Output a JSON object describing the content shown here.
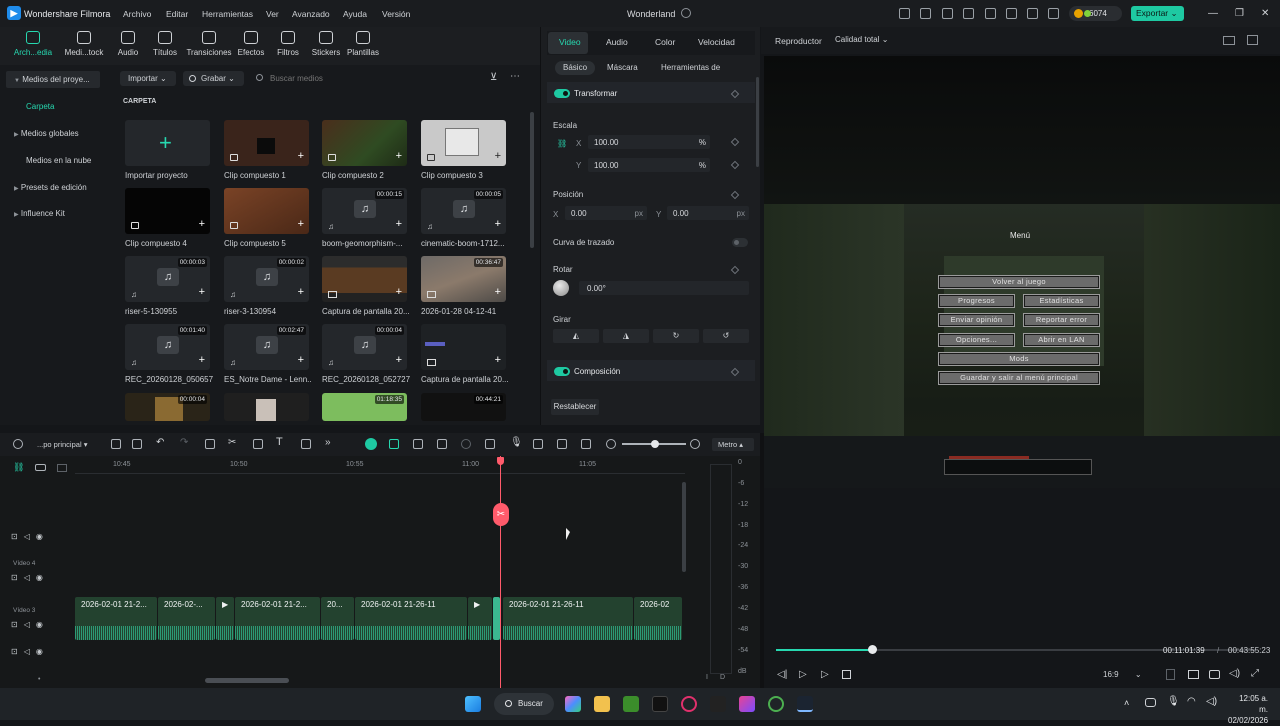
{
  "app": {
    "name": "Wondershare Filmora",
    "project_title": "Wonderland"
  },
  "menu": [
    "Archivo",
    "Editar",
    "Herramientas",
    "Ver",
    "Avanzado",
    "Ayuda",
    "Versión"
  ],
  "credits": "6074",
  "export_label": "Exportar",
  "media_toolbar": [
    "Arch...edia",
    "Medi...tock",
    "Audio",
    "Títulos",
    "Transiciones",
    "Efectos",
    "Filtros",
    "Stickers",
    "Plantillas"
  ],
  "sidebar": [
    "Medios del proye...",
    "Carpeta",
    "Medios globales",
    "Medios en la nube",
    "Presets de edición",
    "Influence Kit"
  ],
  "media_bar": {
    "import": "Importar",
    "record": "Grabar",
    "search_placeholder": "Buscar medios",
    "folder": "CARPETA"
  },
  "media_items": [
    {
      "label": "Importar proyecto",
      "dur": ""
    },
    {
      "label": "Clip compuesto 1",
      "dur": ""
    },
    {
      "label": "Clip compuesto 2",
      "dur": ""
    },
    {
      "label": "Clip compuesto 3",
      "dur": ""
    },
    {
      "label": "Clip compuesto 4",
      "dur": ""
    },
    {
      "label": "Clip compuesto 5",
      "dur": ""
    },
    {
      "label": "boom-geomorphism-...",
      "dur": "00:00:15"
    },
    {
      "label": "cinematic-boom-1712...",
      "dur": "00:00:05"
    },
    {
      "label": "riser-5-130955",
      "dur": "00:00:03"
    },
    {
      "label": "riser-3-130954",
      "dur": "00:00:02"
    },
    {
      "label": "Captura de pantalla 20...",
      "dur": ""
    },
    {
      "label": "2026-01-28 04-12-41",
      "dur": "00:36:47"
    },
    {
      "label": "REC_20260128_050657",
      "dur": "00:01:40"
    },
    {
      "label": "ES_Notre Dame - Lenn...",
      "dur": "00:02:47"
    },
    {
      "label": "REC_20260128_052727",
      "dur": "00:00:04"
    },
    {
      "label": "Captura de pantalla 20...",
      "dur": ""
    },
    {
      "label": "",
      "dur": "00:00:04"
    },
    {
      "label": "",
      "dur": ""
    },
    {
      "label": "",
      "dur": "01:18:35"
    },
    {
      "label": "",
      "dur": "00:44:21"
    }
  ],
  "props": {
    "tabs": [
      "Video",
      "Audio",
      "Color",
      "Velocidad"
    ],
    "subtabs": [
      "Básico",
      "Máscara",
      "Herramientas de"
    ],
    "transform": "Transformar",
    "scale": "Escala",
    "scale_x": "100.00",
    "scale_y": "100.00",
    "percent": "%",
    "x": "X",
    "y": "Y",
    "position": "Posición",
    "pos_x": "0.00",
    "pos_y": "0.00",
    "px": "px",
    "path_curve": "Curva de trazado",
    "rotate": "Rotar",
    "rotate_val": "0.00°",
    "flip": "Girar",
    "composition": "Composición",
    "reset": "Restablecer"
  },
  "player": {
    "label": "Reproductor",
    "quality": "Calidad total",
    "current_time": "00:11:01:39",
    "sep": "/",
    "total_time": "00:43:55:23",
    "progress": 0.2,
    "aspect": "16:9"
  },
  "game_menu": {
    "title": "Menú",
    "back": "Volver al juego",
    "progress": "Progresos",
    "stats": "Estadísticas",
    "feedback": "Enviar opinión",
    "report": "Reportar error",
    "options": "Opciones...",
    "lan": "Abrir en LAN",
    "mods": "Mods",
    "save_quit": "Guardar y salir al menú principal"
  },
  "timeline": {
    "track_name": "...po principal",
    "meter_label": "Metro",
    "ruler": [
      "10:45",
      "10:50",
      "10:55",
      "11:00",
      "11:05"
    ],
    "tracks": [
      "Vídeo 4",
      "Vídeo 3"
    ],
    "clips": [
      "2026-02-01 21-2...",
      "2026-02-...",
      "2026-02-01 21-2...",
      "20...",
      "2026-02-01 21-26-11",
      "2026-02-01 21-26-11",
      "2026-02"
    ],
    "meter": [
      "0",
      "-6",
      "-12",
      "-18",
      "-24",
      "-30",
      "-36",
      "-42",
      "-48",
      "-54",
      "dB"
    ],
    "lr": [
      "I",
      "D"
    ]
  },
  "taskbar": {
    "search": "Buscar",
    "time": "12:05 a. m.",
    "date": "02/02/2026"
  },
  "colors": {
    "accent": "#1ec9a2",
    "playhead": "#ff5b6b"
  }
}
